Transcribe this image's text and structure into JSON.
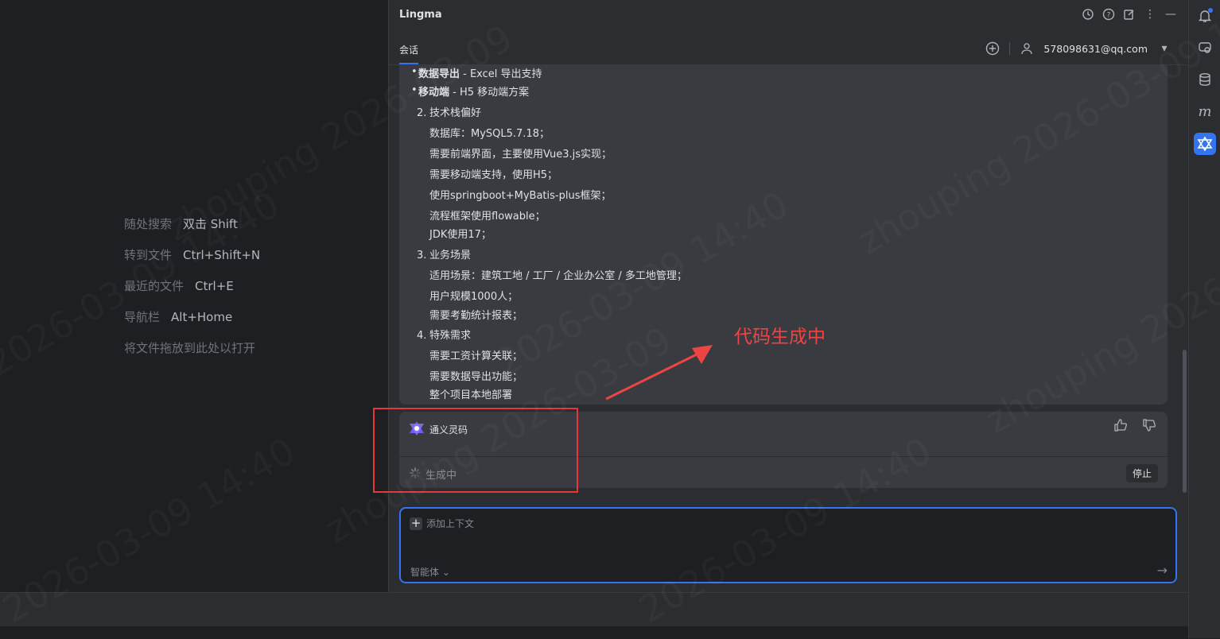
{
  "editor": {
    "hints": [
      {
        "label": "随处搜索",
        "key": "双击 Shift"
      },
      {
        "label": "转到文件",
        "key": "Ctrl+Shift+N"
      },
      {
        "label": "最近的文件",
        "key": "Ctrl+E"
      },
      {
        "label": "导航栏",
        "key": "Alt+Home"
      }
    ],
    "drop_hint": "将文件拖放到此处以打开"
  },
  "panel": {
    "title": "Lingma",
    "tab": "会话",
    "account": "578098631@qq.com"
  },
  "message": {
    "bullets": [
      {
        "bold": "数据导出",
        "text": " - Excel 导出支持"
      },
      {
        "bold": "移动端",
        "text": " - H5 移动端方案"
      }
    ],
    "sections": [
      {
        "num": "2.",
        "title": "技术栈偏好",
        "items": [
          "数据库：MySQL5.7.18；",
          "需要前端界面，主要使用Vue3.js实现；",
          "需要移动端支持，使用H5；",
          "使用springboot+MyBatis-plus框架；",
          "流程框架使用flowable；",
          "JDK使用17；"
        ]
      },
      {
        "num": "3.",
        "title": "业务场景",
        "items": [
          "适用场景：建筑工地 / 工厂 / 企业办公室 / 多工地管理；",
          "用户规模1000人；",
          "需要考勤统计报表；"
        ]
      },
      {
        "num": "4.",
        "title": "特殊需求",
        "items": [
          "需要工资计算关联；",
          "需要数据导出功能；",
          "整个项目本地部署"
        ]
      }
    ]
  },
  "assistant": {
    "name": "通义灵码",
    "status": "生成中",
    "stop_label": "停止"
  },
  "annotation": "代码生成中",
  "input": {
    "add_context": "添加上下文",
    "agent": "智能体"
  },
  "icons": {
    "top": [
      "history-icon",
      "help-icon",
      "edit-icon",
      "more-icon",
      "minimize-icon"
    ],
    "rail": [
      "bell-icon",
      "ai-chat-icon",
      "database-icon",
      "m-icon",
      "lingma-icon"
    ]
  },
  "colors": {
    "accent": "#3574f0",
    "annotation": "#ef4444"
  }
}
